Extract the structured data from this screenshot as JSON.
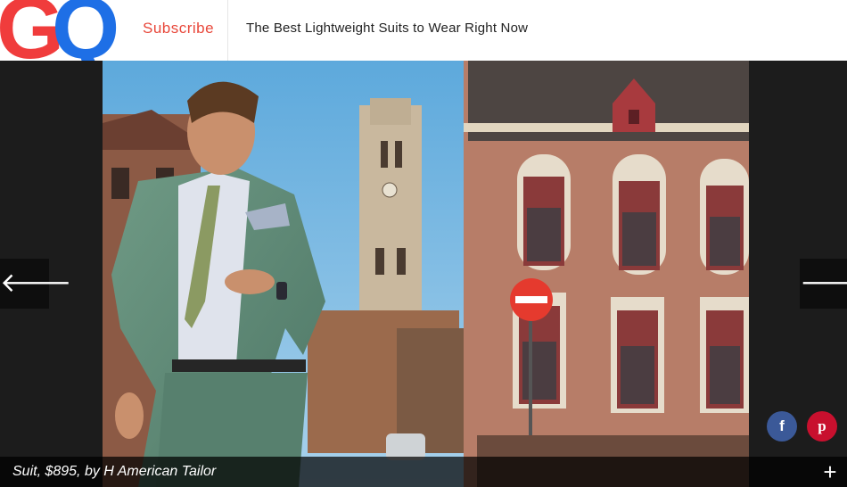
{
  "header": {
    "logo_g": "G",
    "logo_q": "Q",
    "subscribe_label": "Subscribe",
    "headline": "The Best Lightweight Suits to Wear Right Now"
  },
  "slideshow": {
    "photo_icon": "fashion-photo",
    "prev_icon": "arrow-left-icon",
    "next_icon": "arrow-right-icon",
    "prev_glyph": "🡐",
    "next_glyph": "🡒",
    "caption": "Suit, $895, by H American Tailor",
    "expand_glyph": "+"
  },
  "social": {
    "facebook_glyph": "f",
    "pinterest_glyph": "p"
  },
  "colors": {
    "logo_red": "#f03c3c",
    "logo_blue": "#1e6fe6",
    "subscribe_red": "#e8483b",
    "facebook": "#3b5998",
    "pinterest": "#c8102e"
  }
}
